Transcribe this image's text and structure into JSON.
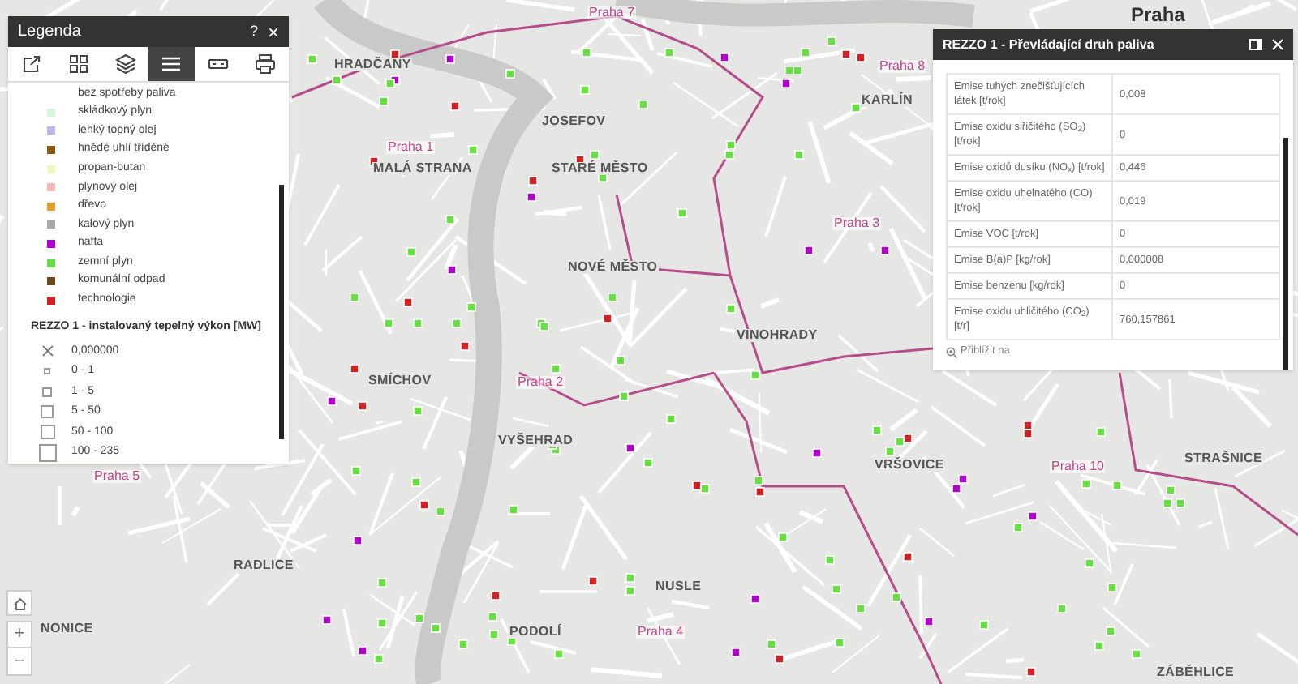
{
  "map_labels": [
    {
      "text": "HRADČANY",
      "kind": "district"
    },
    {
      "text": "Praha 7",
      "kind": "admin"
    },
    {
      "text": "Praha",
      "kind": "city"
    },
    {
      "text": "Praha 8",
      "kind": "admin"
    },
    {
      "text": "KARLÍN",
      "kind": "district"
    },
    {
      "text": "JOSEFOV",
      "kind": "district"
    },
    {
      "text": "Praha 1",
      "kind": "admin"
    },
    {
      "text": "MALÁ STRANA",
      "kind": "district"
    },
    {
      "text": "STARÉ MĚSTO",
      "kind": "district"
    },
    {
      "text": "Praha 3",
      "kind": "admin"
    },
    {
      "text": "NOVÉ MĚSTO",
      "kind": "district"
    },
    {
      "text": "VINOHRADY",
      "kind": "district"
    },
    {
      "text": "SMÍCHOV",
      "kind": "district"
    },
    {
      "text": "Praha 2",
      "kind": "admin"
    },
    {
      "text": "VYŠEHRAD",
      "kind": "district"
    },
    {
      "text": "Praha 5",
      "kind": "admin"
    },
    {
      "text": "VRŠOVICE",
      "kind": "district"
    },
    {
      "text": "Praha 10",
      "kind": "admin"
    },
    {
      "text": "STRAŠNICE",
      "kind": "district"
    },
    {
      "text": "RADLICE",
      "kind": "district"
    },
    {
      "text": "NUSLE",
      "kind": "district"
    },
    {
      "text": "NONICE",
      "kind": "district"
    },
    {
      "text": "PODOLÍ",
      "kind": "district"
    },
    {
      "text": "Praha 4",
      "kind": "admin"
    },
    {
      "text": "ZÁBĚHLICE",
      "kind": "district"
    }
  ],
  "legend": {
    "title": "Legenda",
    "help": "?",
    "close": "×",
    "tools": [
      {
        "selected": false
      },
      {
        "selected": false
      },
      {
        "selected": false
      },
      {
        "selected": true
      },
      {
        "selected": false
      },
      {
        "selected": false
      }
    ],
    "fuel_items": [
      {
        "label": "bez spotřeby paliva"
      },
      {
        "label": "skládkový plyn",
        "color": "#d6f5d6"
      },
      {
        "label": "lehký topný olej",
        "color": "#b9b9f0"
      },
      {
        "label": "hnědé uhlí tříděné",
        "color": "#8a5a12"
      },
      {
        "label": "propan-butan",
        "color": "#f5f5c0"
      },
      {
        "label": "plynový olej",
        "color": "#f5b8b8"
      },
      {
        "label": "dřevo",
        "color": "#e0a030"
      },
      {
        "label": "kalový plyn",
        "color": "#a8a8a8"
      },
      {
        "label": "nafta",
        "color": "#b000d0"
      },
      {
        "label": "zemní plyn",
        "color": "#66e040"
      },
      {
        "label": "komunální odpad",
        "color": "#6a4a18"
      },
      {
        "label": "technologie",
        "color": "#d42020"
      }
    ],
    "size_title": "REZZO 1 - instalovaný tepelný výkon [MW]",
    "size_items": [
      {
        "label": "0,000000",
        "kind": "cross"
      },
      {
        "label": "0 - 1",
        "kind": "square1"
      },
      {
        "label": "1 - 5",
        "kind": "square2"
      },
      {
        "label": "5 - 50",
        "kind": "square3"
      },
      {
        "label": "50 - 100",
        "kind": "square4"
      },
      {
        "label": "100 - 235",
        "kind": "square5"
      }
    ]
  },
  "popup": {
    "title": "REZZO 1 - Převládající druh paliva",
    "rows": [
      {
        "name": "Emise tuhých znečišťujících látek [t/rok]",
        "value": "0,008"
      },
      {
        "name": "Emise oxidu siřičitého (SO$_{2}$) [t/rok]",
        "value": "0"
      },
      {
        "name": "Emise oxidů dusíku (NO$_{x}$) [t/rok]",
        "value": "0,446"
      },
      {
        "name": "Emise oxidu uhelnatého (CO) [t/rok]",
        "value": "0,019"
      },
      {
        "name": "Emise VOC [t/rok]",
        "value": "0"
      },
      {
        "name": "Emise B(a)P [kg/rok]",
        "value": "0,000008"
      },
      {
        "name": "Emise benzenu [kg/rok]",
        "value": "0"
      },
      {
        "name": "Emise oxidu uhličitého (CO$_{2}$) [t/r]",
        "value": "760,157861"
      }
    ],
    "zoom_link": "Přiblížit na"
  },
  "zoom_controls": {
    "plus": "+",
    "minus": "−"
  }
}
